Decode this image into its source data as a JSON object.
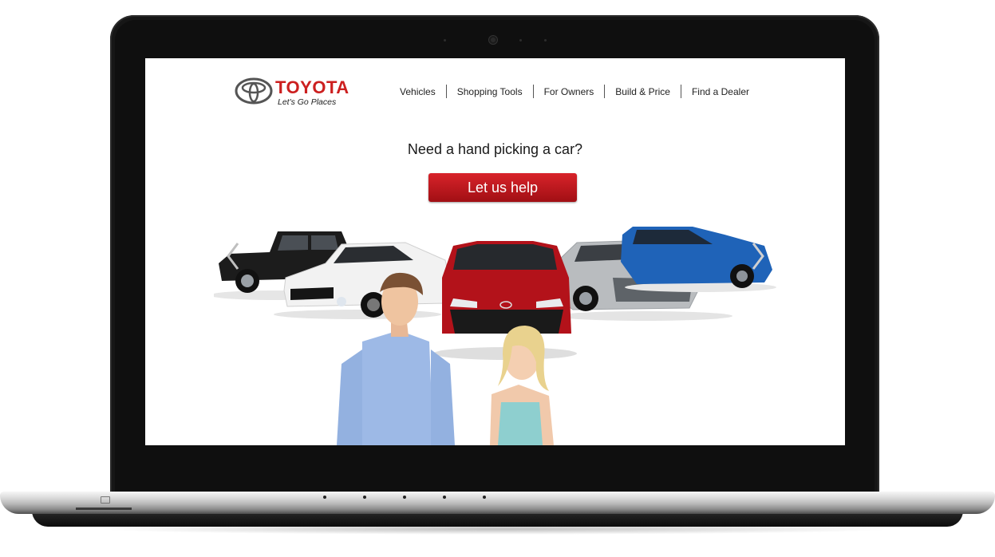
{
  "header": {
    "brand_name": "TOYOTA",
    "tagline": "Let's Go Places"
  },
  "nav": {
    "items": [
      {
        "label": "Vehicles"
      },
      {
        "label": "Shopping Tools"
      },
      {
        "label": "For Owners"
      },
      {
        "label": "Build & Price"
      },
      {
        "label": "Find a Dealer"
      }
    ]
  },
  "hero": {
    "headline": "Need a hand picking a car?",
    "cta_label": "Let us help"
  },
  "carousel": {
    "prev_icon": "chevron-left-icon",
    "next_icon": "chevron-right-icon"
  },
  "colors": {
    "brand_red": "#cc1f1f",
    "cta_red": "#c0161c",
    "car_black": "#1c1c1c",
    "car_white": "#f2f2f2",
    "car_red": "#b3121a",
    "car_silver": "#b9bcbf",
    "car_blue": "#1f63b8"
  }
}
